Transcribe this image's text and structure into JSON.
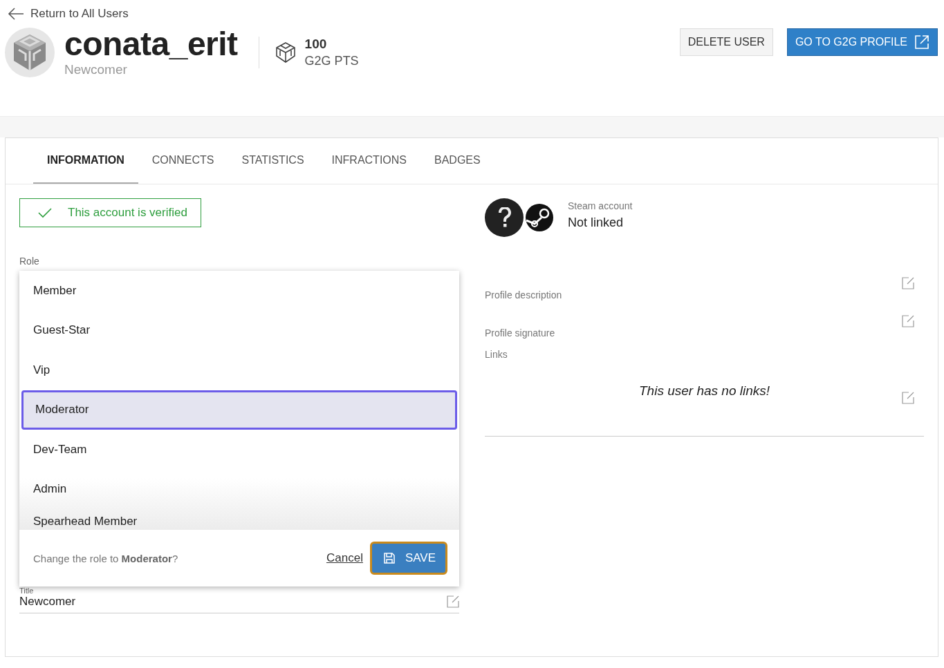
{
  "back_link": "Return to All Users",
  "user": {
    "name": "conata_erit",
    "rank": "Newcomer"
  },
  "points": {
    "value": "100",
    "unit": "G2G PTS"
  },
  "actions": [
    {
      "label": "DELETE USER",
      "kind": "secondary"
    },
    {
      "label": "GO TO G2G PROFILE",
      "kind": "primary"
    }
  ],
  "tabs": [
    {
      "label": "INFORMATION",
      "selected": true
    },
    {
      "label": "CONNECTS",
      "selected": false
    },
    {
      "label": "STATISTICS",
      "selected": false
    },
    {
      "label": "INFRACTIONS",
      "selected": false
    },
    {
      "label": "BADGES",
      "selected": false
    }
  ],
  "verified": {
    "text": "This account is verified"
  },
  "role": {
    "label": "Role",
    "options": [
      {
        "label": "Member",
        "selected": false
      },
      {
        "label": "Guest-Star",
        "selected": false
      },
      {
        "label": "Vip",
        "selected": false
      },
      {
        "label": "Moderator",
        "selected": true
      },
      {
        "label": "Dev-Team",
        "selected": false
      },
      {
        "label": "Admin",
        "selected": false
      },
      {
        "label": "Spearhead Member",
        "selected": false
      }
    ],
    "confirm": {
      "text": "Change the role to **Moderator**?",
      "cancel": "Cancel",
      "save": "SAVE"
    }
  },
  "title_field": {
    "label": "Title",
    "value": "Newcomer"
  },
  "steam": {
    "label": "Steam account",
    "status": "Not linked"
  },
  "profile_fields": [
    {
      "label": "Profile description"
    },
    {
      "label": "Profile signature"
    }
  ],
  "links": {
    "label": "Links",
    "empty_text": "This user has no links!"
  }
}
